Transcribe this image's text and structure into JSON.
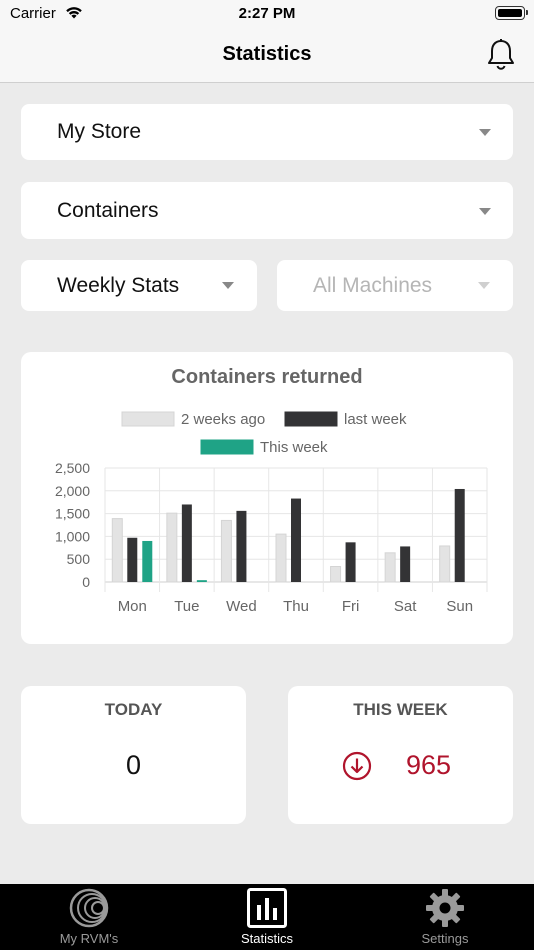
{
  "status_bar": {
    "carrier": "Carrier",
    "time": "2:27 PM"
  },
  "nav": {
    "title": "Statistics",
    "bell_icon": "bell-icon"
  },
  "filters": {
    "store": "My Store",
    "category": "Containers",
    "period": "Weekly Stats",
    "machines": "All Machines"
  },
  "chart_data": {
    "type": "bar",
    "title": "Containers returned",
    "categories": [
      "Mon",
      "Tue",
      "Wed",
      "Thu",
      "Fri",
      "Sat",
      "Sun"
    ],
    "series": [
      {
        "name": "2 weeks ago",
        "color": "#e3e3e3",
        "values": [
          1390,
          1510,
          1350,
          1050,
          340,
          640,
          790
        ]
      },
      {
        "name": "last week",
        "color": "#333335",
        "values": [
          970,
          1700,
          1560,
          1830,
          870,
          780,
          2040
        ]
      },
      {
        "name": "This week",
        "color": "#1fa386",
        "values": [
          900,
          40,
          null,
          null,
          null,
          null,
          null
        ]
      }
    ],
    "y_ticks": [
      "2,500",
      "2,000",
      "1,500",
      "1,000",
      "500",
      "0"
    ],
    "ylim": [
      0,
      2500
    ],
    "grid": true,
    "legend_position": "top"
  },
  "stats": {
    "today_label": "TODAY",
    "today_value": "0",
    "week_label": "THIS WEEK",
    "week_value": "965",
    "trend_icon": "arrow-down-circle-icon",
    "trend_color": "#b0142c"
  },
  "tabs": [
    {
      "label": "My RVM's",
      "icon": "rvm-rings-icon"
    },
    {
      "label": "Statistics",
      "icon": "bar-chart-icon"
    },
    {
      "label": "Settings",
      "icon": "gear-icon"
    }
  ]
}
